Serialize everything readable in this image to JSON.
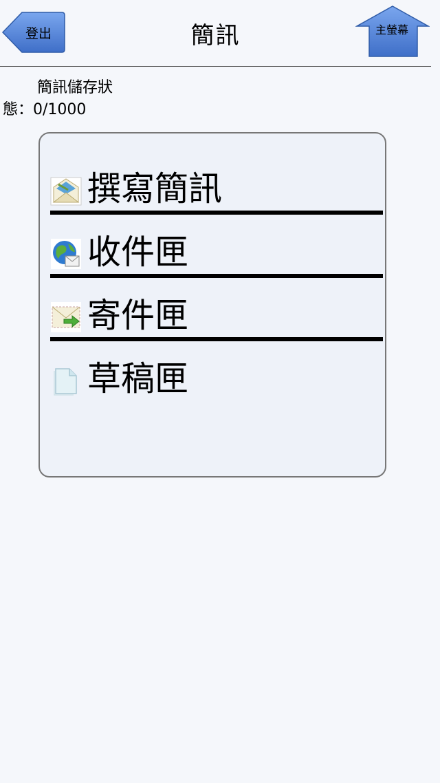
{
  "header": {
    "logout_label": "登出",
    "title": "簡訊",
    "home_label": "主螢幕"
  },
  "storage": {
    "line1": "簡訊儲存狀",
    "line2": "態：0/1000"
  },
  "menu": {
    "items": [
      {
        "label": "撰寫簡訊",
        "icon": "compose-envelope-icon"
      },
      {
        "label": "收件匣",
        "icon": "globe-mail-icon"
      },
      {
        "label": "寄件匣",
        "icon": "outbox-envelope-icon"
      },
      {
        "label": "草稿匣",
        "icon": "document-icon"
      }
    ]
  },
  "colors": {
    "button_blue": "#4f7fd6",
    "panel_bg": "#eef2f9",
    "page_bg": "#f5f7fb"
  }
}
